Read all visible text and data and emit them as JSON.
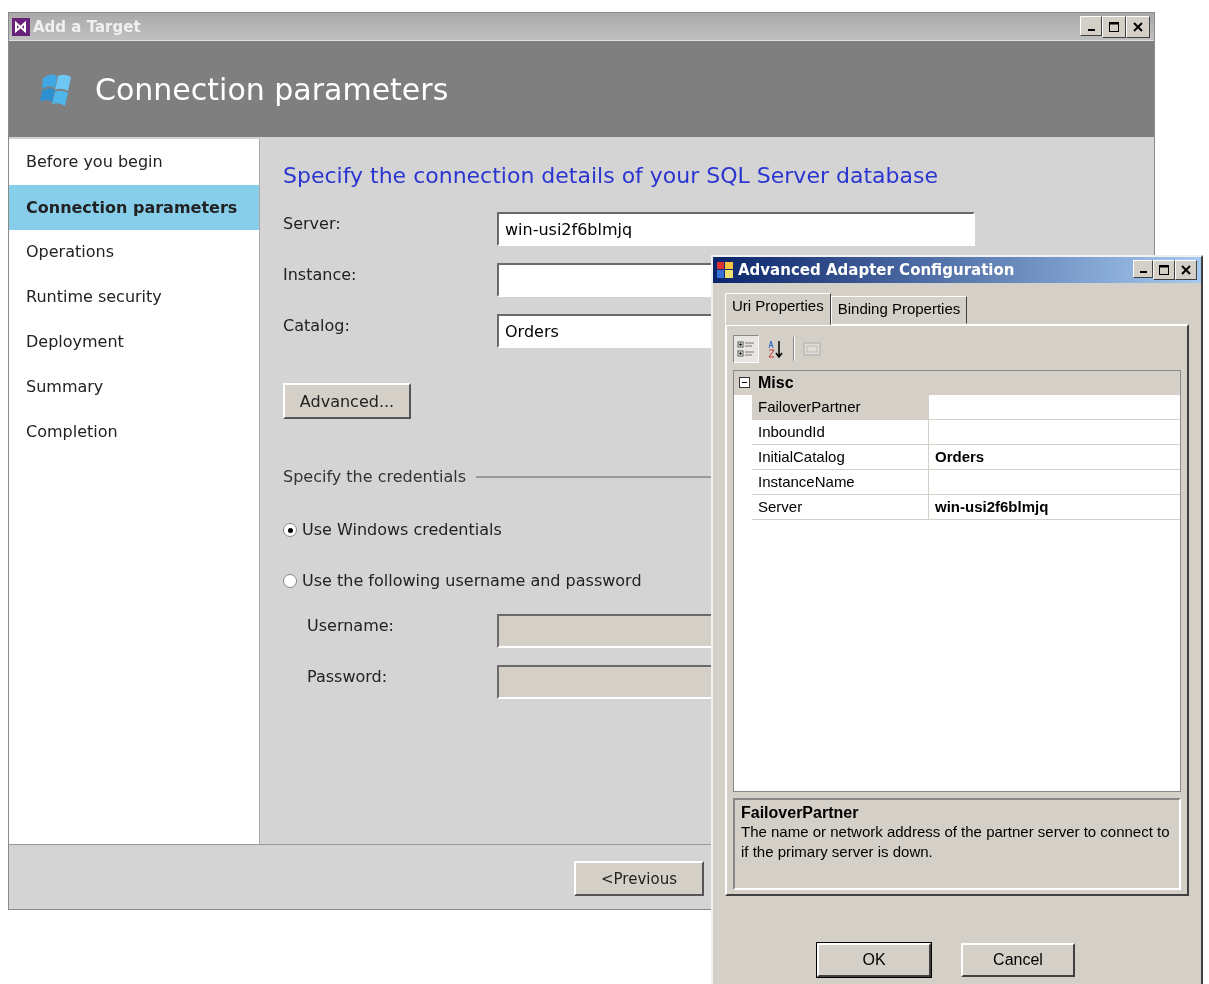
{
  "main_window": {
    "title": "Add a Target",
    "header_title": "Connection parameters",
    "steps": [
      {
        "label": "Before you begin",
        "selected": false
      },
      {
        "label": "Connection parameters",
        "selected": true
      },
      {
        "label": "Operations",
        "selected": false
      },
      {
        "label": "Runtime security",
        "selected": false
      },
      {
        "label": "Deployment",
        "selected": false
      },
      {
        "label": "Summary",
        "selected": false
      },
      {
        "label": "Completion",
        "selected": false
      }
    ],
    "heading": "Specify the connection details of your SQL Server database",
    "fields": [
      {
        "label": "Server:",
        "value": "win-usi2f6blmjq"
      },
      {
        "label": "Instance:"
      },
      {
        "label": "Catalog:",
        "value": "Orders"
      }
    ],
    "advanced_button": "Advanced...",
    "credentials_heading": "Specify the credentials",
    "options": [
      {
        "label": "Use Windows credentials",
        "selected": true
      },
      {
        "label": "Use the following username and password",
        "selected": false
      }
    ],
    "credential_fields": [
      {
        "label": "Username:",
        "disabled": true
      },
      {
        "label": "Password:",
        "disabled": true
      }
    ],
    "previous_button": "<Previous"
  },
  "dialog": {
    "title": "Advanced Adapter Configuration",
    "tabs": [
      {
        "label": "Uri Properties",
        "selected": true
      },
      {
        "label": "Binding Properties",
        "selected": false
      }
    ],
    "toolbar": [
      {
        "kind": "categorized",
        "selected": true
      },
      {
        "kind": "alphabetical",
        "selected": false
      },
      {
        "kind": "pages",
        "selected": false
      }
    ],
    "category": {
      "label": "Misc",
      "expanded": true
    },
    "properties": [
      {
        "name": "FailoverPartner",
        "selected": true
      },
      {
        "name": "InboundId",
        "selected": false
      },
      {
        "name": "InitialCatalog",
        "value": "Orders",
        "selected": false
      },
      {
        "name": "InstanceName",
        "selected": false
      },
      {
        "name": "Server",
        "value": "win-usi2f6blmjq",
        "selected": false
      }
    ],
    "description": {
      "title": "FailoverPartner",
      "text": "The name or network address of the partner server to connect to if the primary server is down."
    },
    "buttons": [
      "OK",
      "Cancel"
    ]
  }
}
